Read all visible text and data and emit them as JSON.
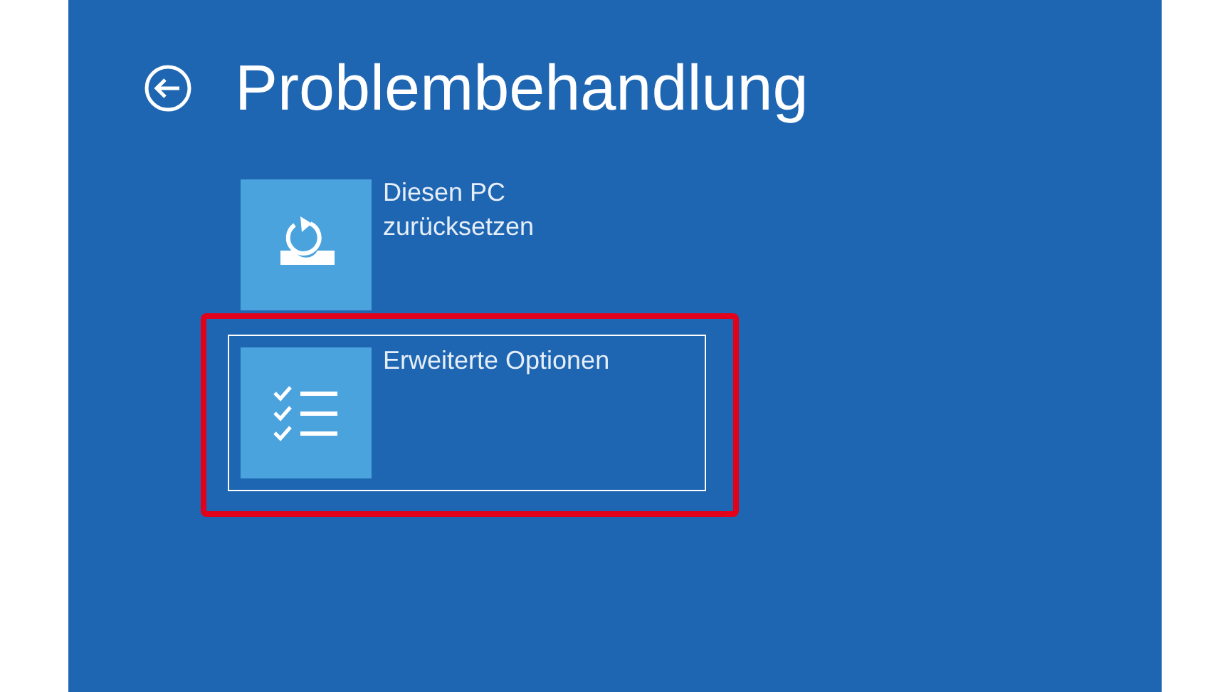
{
  "title": "Problembehandlung",
  "options": [
    {
      "label": "Diesen PC\nzurücksetzen",
      "kind": "reset",
      "selected": false,
      "highlighted": false
    },
    {
      "label": "Erweiterte Optionen",
      "kind": "advanced",
      "selected": true,
      "highlighted": true
    }
  ]
}
